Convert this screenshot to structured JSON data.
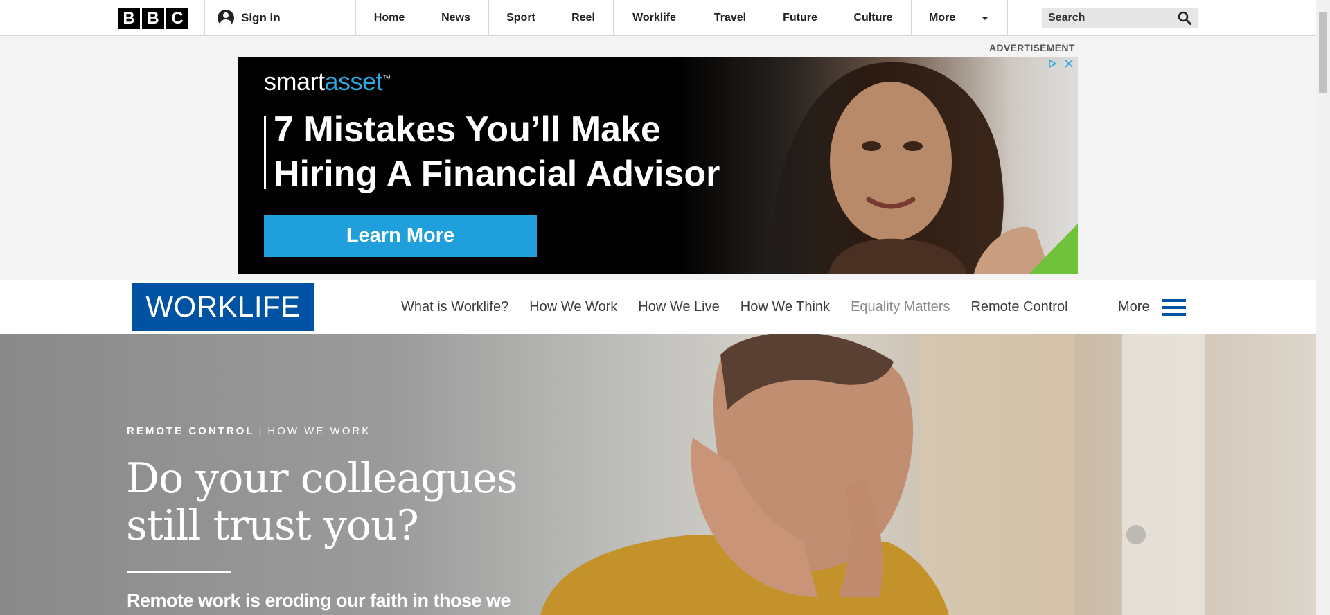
{
  "bbc": {
    "logo_letters": [
      "B",
      "B",
      "C"
    ],
    "sign_in_label": "Sign in",
    "nav": [
      "Home",
      "News",
      "Sport",
      "Reel",
      "Worklife",
      "Travel",
      "Future",
      "Culture"
    ],
    "more_label": "More",
    "search_placeholder": "Search"
  },
  "ad": {
    "label": "ADVERTISEMENT",
    "brand_plain": "smart",
    "brand_highlight": "asset",
    "brand_mark": "™",
    "headline_line1": "7 Mistakes You’ll Make",
    "headline_line2": "Hiring A Financial Advisor",
    "cta_label": "Learn More",
    "cta_color": "#1fa0dc"
  },
  "worklife": {
    "logo": "WORKLIFE",
    "logo_color": "#0052a3",
    "nav": [
      "What is Worklife?",
      "How We Work",
      "How We Live",
      "How We Think",
      "Equality Matters",
      "Remote Control"
    ],
    "more_label": "More"
  },
  "hero": {
    "kicker_primary": "REMOTE CONTROL",
    "kicker_separator": "|",
    "kicker_secondary": "HOW WE WORK",
    "title_line1": "Do your colleagues",
    "title_line2": "still trust you?",
    "summary": "Remote work is eroding our faith in those we"
  }
}
